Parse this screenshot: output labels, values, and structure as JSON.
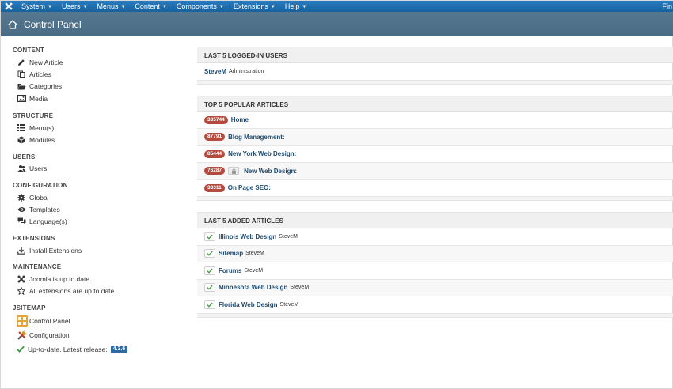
{
  "topnav": {
    "items": [
      "System",
      "Users",
      "Menus",
      "Content",
      "Components",
      "Extensions",
      "Help"
    ],
    "right_text": "Fin"
  },
  "header": {
    "title": "Control Panel"
  },
  "sidebar": {
    "content": {
      "title": "CONTENT",
      "items": [
        "New Article",
        "Articles",
        "Categories",
        "Media"
      ]
    },
    "structure": {
      "title": "STRUCTURE",
      "items": [
        "Menu(s)",
        "Modules"
      ]
    },
    "users": {
      "title": "USERS",
      "items": [
        "Users"
      ]
    },
    "configuration": {
      "title": "CONFIGURATION",
      "items": [
        "Global",
        "Templates",
        "Language(s)"
      ]
    },
    "extensions": {
      "title": "EXTENSIONS",
      "items": [
        "Install Extensions"
      ]
    },
    "maintenance": {
      "title": "MAINTENANCE",
      "items": [
        "Joomla is up to date.",
        "All extensions are up to date."
      ]
    },
    "jsitemap": {
      "title": "JSITEMAP",
      "items": [
        "Control Panel",
        "Configuration",
        "Up-to-date. Latest release:"
      ],
      "version": "4.3.6"
    }
  },
  "panels": {
    "logged_in": {
      "title": "LAST 5 LOGGED-IN USERS",
      "rows": [
        {
          "name": "SteveM",
          "role": "Administration"
        }
      ]
    },
    "popular": {
      "title": "TOP 5 POPULAR ARTICLES",
      "rows": [
        {
          "hits": "335744",
          "title": "Home"
        },
        {
          "hits": "87791",
          "title": "Blog Management:"
        },
        {
          "hits": "85444",
          "title": "New York Web Design:"
        },
        {
          "hits": "76287",
          "title": "New Web Design:"
        },
        {
          "hits": "33311",
          "title": "On Page SEO:"
        }
      ]
    },
    "added": {
      "title": "LAST 5 ADDED ARTICLES",
      "rows": [
        {
          "title": "Illinois Web Design",
          "author": "SteveM"
        },
        {
          "title": "Sitemap",
          "author": "SteveM"
        },
        {
          "title": "Forums",
          "author": "SteveM"
        },
        {
          "title": "Minnesota Web Design",
          "author": "SteveM"
        },
        {
          "title": "Florida Web Design",
          "author": "SteveM"
        }
      ]
    }
  },
  "colors": {
    "navbar": "#1b6fb1",
    "header": "#4d6f89",
    "hits_badge": "#b54a3f",
    "version_badge": "#2f6aa3",
    "link": "#1f4a6e"
  }
}
